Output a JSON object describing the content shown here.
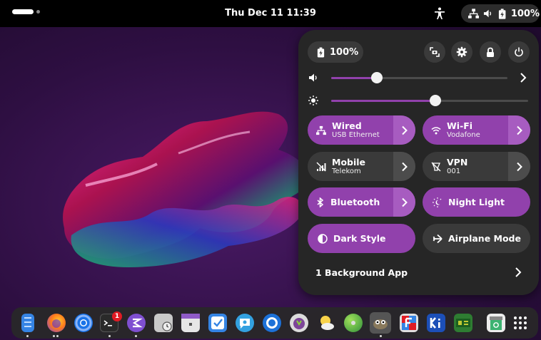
{
  "topbar": {
    "clock": "Thu Dec 11  11:39",
    "battery_label": "100%"
  },
  "quick_settings": {
    "battery_label": "100%",
    "volume_level": 0.26,
    "brightness_level": 0.53,
    "tiles": {
      "wired": {
        "title": "Wired",
        "subtitle": "USB Ethernet",
        "active": true
      },
      "wifi": {
        "title": "Wi-Fi",
        "subtitle": "Vodafone",
        "active": true
      },
      "mobile": {
        "title": "Mobile",
        "subtitle": "Telekom",
        "active": false
      },
      "vpn": {
        "title": "VPN",
        "subtitle": "001",
        "active": false
      },
      "bluetooth": {
        "title": "Bluetooth",
        "active": true
      },
      "night_light": {
        "title": "Night Light",
        "active": true
      },
      "dark_style": {
        "title": "Dark Style",
        "active": true
      },
      "airplane_mode": {
        "title": "Airplane Mode",
        "active": false
      }
    },
    "background_apps": "1 Background App"
  },
  "dock": {
    "terminal_badge": "1"
  },
  "colors": {
    "accent": "#9141ac",
    "panel": "#262626",
    "tile_off": "#3a3a3a"
  }
}
